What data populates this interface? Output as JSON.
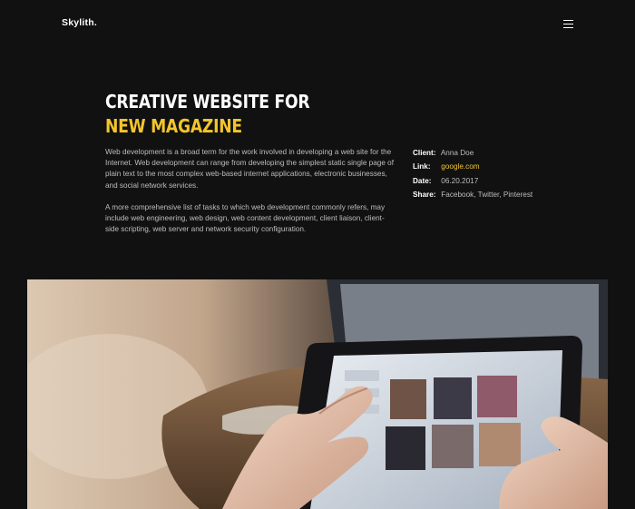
{
  "header": {
    "logo": "Skylith.",
    "menu_icon": "hamburger-menu-icon"
  },
  "project": {
    "title_main": "CREATIVE WEBSITE FOR ",
    "title_accent": "NEW MAGAZINE",
    "description": [
      "Web development is a broad term for the work involved in developing a web site for the Internet. Web development can range from developing the simplest static single page of plain text to the most complex web-based internet applications, electronic businesses, and social network services.",
      "A more comprehensive list of tasks to which web development commonly refers, may include web engineering, web design, web content development, client liaison, client-side scripting, web server and network security configuration."
    ],
    "meta": {
      "client_label": "Client:",
      "client_value": "Anna Doe",
      "link_label": "Link:",
      "link_value": "google.com",
      "date_label": "Date:",
      "date_value": "06.20.2017",
      "share_label": "Share:",
      "share_facebook": "Facebook",
      "share_twitter": "Twitter",
      "share_pinterest": "Pinterest",
      "share_separator": ", "
    }
  },
  "colors": {
    "background": "#111112",
    "accent": "#f2c52b",
    "heading": "#ffffff",
    "body_text": "#bdbdbd"
  }
}
